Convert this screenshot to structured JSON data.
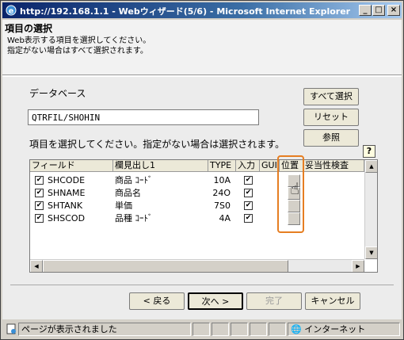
{
  "window": {
    "title": "http://192.168.1.1 - Webウィザード(5/6) - Microsoft Internet Explorer",
    "minimize_label": "_",
    "maximize_label": "□",
    "close_label": "×"
  },
  "header": {
    "title": "項目の選択",
    "desc_line1": "Web表示する項目を選択してください。",
    "desc_line2": "指定がない場合はすべて選択されます。"
  },
  "form": {
    "database_label": "データベース",
    "database_value": "QTRFIL/SHOHIN",
    "instruction": "項目を選択してください。指定がない場合は選択されます。",
    "select_all_label": "すべて選択",
    "reset_label": "リセット",
    "browse_label": "参照",
    "help_label": "?"
  },
  "grid": {
    "headers": [
      "フィールド",
      "欄見出し1",
      "TYPE",
      "入力",
      "GUI",
      "位置",
      "妥当性検査"
    ],
    "rows": [
      {
        "field": "SHCODE",
        "heading": "商品 ｺｰﾄﾞ",
        "type": "10A",
        "checked": true,
        "input": true
      },
      {
        "field": "SHNAME",
        "heading": "商品名",
        "type": "24O",
        "checked": true,
        "input": true
      },
      {
        "field": "SHTANK",
        "heading": "単価",
        "type": "7S0",
        "checked": true,
        "input": true
      },
      {
        "field": "SHSCOD",
        "heading": "品種 ｺｰﾄﾞ",
        "type": "4A",
        "checked": true,
        "input": true
      }
    ]
  },
  "nav": {
    "back_label": "< 戻る",
    "next_label": "次へ >",
    "finish_label": "完了",
    "cancel_label": "キャンセル"
  },
  "status": {
    "text": "ページが表示されました",
    "zone": "インターネット"
  },
  "colors": {
    "title_start": "#0a246a",
    "title_end": "#a6caf0",
    "highlight": "#e67e22"
  }
}
